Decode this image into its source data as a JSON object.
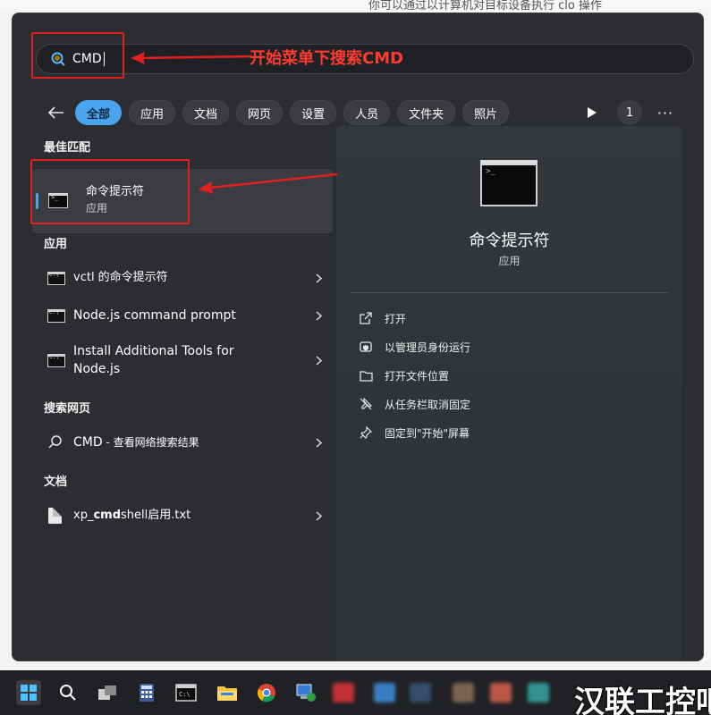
{
  "background": {
    "doc_text_fragment": "你可以通过以计算机对目标设备执行 clo 操作"
  },
  "search": {
    "value": "CMD"
  },
  "annotations": {
    "search_note": "开始菜单下搜索CMD",
    "color": "#ff3b30"
  },
  "filters": {
    "chips": [
      "全部",
      "应用",
      "文档",
      "网页",
      "设置",
      "人员",
      "文件夹",
      "照片"
    ],
    "count": "1",
    "more": "···"
  },
  "best_match": {
    "section": "最佳匹配",
    "title": "命令提示符",
    "subtitle": "应用"
  },
  "apps": {
    "section": "应用",
    "items": [
      {
        "label": "vctl 的命令提示符"
      },
      {
        "label": "Node.js command prompt"
      },
      {
        "label": "Install Additional Tools for Node.js"
      }
    ]
  },
  "web": {
    "section": "搜索网页",
    "query": "CMD",
    "suffix": " - 查看网络搜索结果"
  },
  "docs": {
    "section": "文档",
    "prefix": "xp_",
    "highlight": "cmd",
    "rest": "shell启用.txt"
  },
  "detail": {
    "title": "命令提示符",
    "subtitle": "应用",
    "actions": [
      {
        "label": "打开",
        "icon": "open-external-icon"
      },
      {
        "label": "以管理员身份运行",
        "icon": "shield-admin-icon"
      },
      {
        "label": "打开文件位置",
        "icon": "folder-icon"
      },
      {
        "label": "从任务栏取消固定",
        "icon": "unpin-icon"
      },
      {
        "label": "固定到\"开始\"屏幕",
        "icon": "pin-icon"
      }
    ]
  },
  "watermark": "汉联工控吧",
  "colors": {
    "accent": "#4aa3ee",
    "panel": "#2b2d31",
    "annotation": "#e02020"
  }
}
